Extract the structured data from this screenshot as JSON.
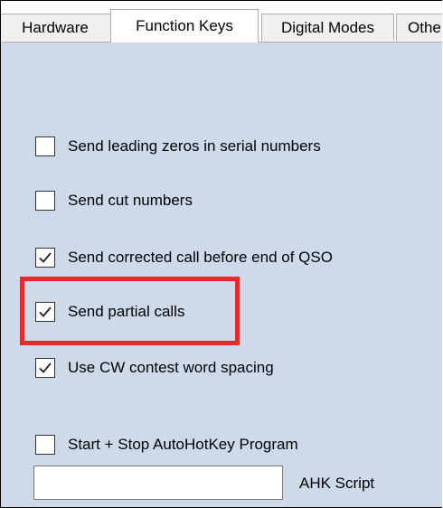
{
  "tabs": [
    {
      "label": "Hardware",
      "active": false
    },
    {
      "label": "Function Keys",
      "active": true
    },
    {
      "label": "Digital Modes",
      "active": false
    },
    {
      "label": "Other",
      "active": false
    }
  ],
  "options": [
    {
      "label": "Send leading zeros in serial numbers",
      "checked": false
    },
    {
      "label": "Send cut numbers",
      "checked": false
    },
    {
      "label": "Send corrected call before end of QSO",
      "checked": true
    },
    {
      "label": "Send partial calls",
      "checked": true,
      "highlighted": true
    },
    {
      "label": "Use CW contest word spacing",
      "checked": true
    }
  ],
  "autohotkey": {
    "label": "Start + Stop AutoHotKey Program",
    "checked": false,
    "script_value": "",
    "script_label": "AHK Script"
  },
  "colors": {
    "panel_background": "#ccdaea",
    "highlight_border": "#e32b2b"
  }
}
